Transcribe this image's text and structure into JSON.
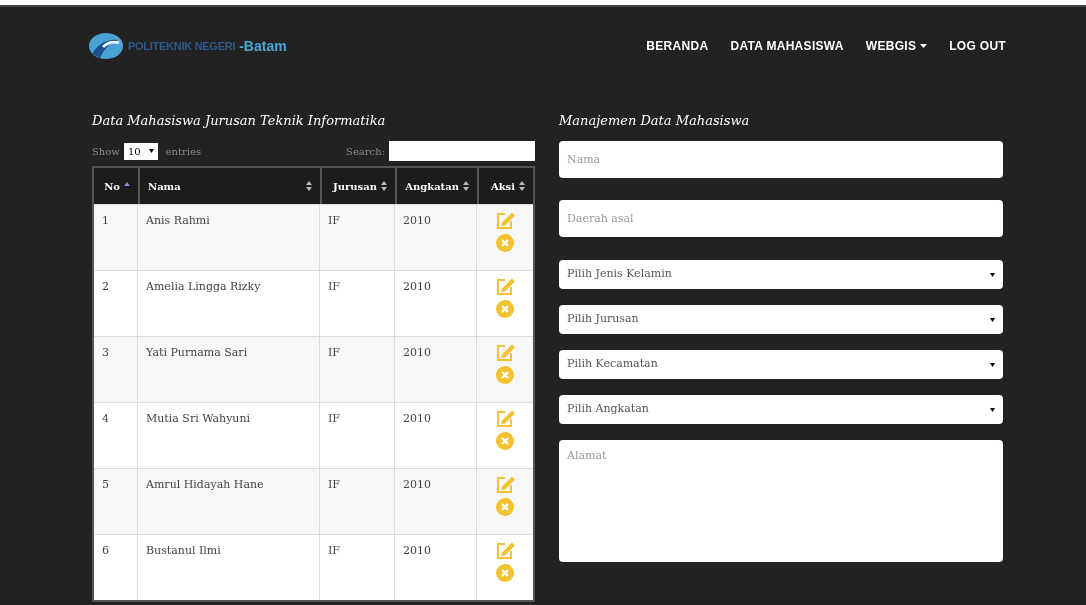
{
  "logo": {
    "prefix": "POLITEKNIK NEGERI",
    "suffix": "-Batam"
  },
  "nav": [
    {
      "label": "BERANDA",
      "dropdown": false
    },
    {
      "label": "DATA MAHASISWA",
      "dropdown": false
    },
    {
      "label": "WEBGIS",
      "dropdown": true
    },
    {
      "label": "LOG OUT",
      "dropdown": false
    }
  ],
  "table_section": {
    "title": "Data Mahasiswa Jurusan Teknik Informatika",
    "show_label": "Show",
    "page_size": "10",
    "entries_label": "entries",
    "search_label": "Search:",
    "columns": [
      {
        "label": "No",
        "sorted": true
      },
      {
        "label": "Nama",
        "sorted": false
      },
      {
        "label": "Jurusan",
        "sorted": false
      },
      {
        "label": "Angkatan",
        "sorted": false
      },
      {
        "label": "Aksi",
        "sorted": false
      }
    ],
    "rows": [
      {
        "no": "1",
        "nama": "Anis Rahmi",
        "jurusan": "IF",
        "angkatan": "2010"
      },
      {
        "no": "2",
        "nama": "Amelia Lingga Rizky",
        "jurusan": "IF",
        "angkatan": "2010"
      },
      {
        "no": "3",
        "nama": "Yati Purnama Sari",
        "jurusan": "IF",
        "angkatan": "2010"
      },
      {
        "no": "4",
        "nama": "Mutia Sri Wahyuni",
        "jurusan": "IF",
        "angkatan": "2010"
      },
      {
        "no": "5",
        "nama": "Amrul Hidayah Hane",
        "jurusan": "IF",
        "angkatan": "2010"
      },
      {
        "no": "6",
        "nama": "Bustanul Ilmi",
        "jurusan": "IF",
        "angkatan": "2010"
      }
    ]
  },
  "form": {
    "title": "Manajemen Data Mahasiswa",
    "fields": [
      {
        "kind": "text",
        "placeholder": "Nama"
      },
      {
        "kind": "text",
        "placeholder": "Daerah asal"
      },
      {
        "kind": "select",
        "placeholder": "Pilih Jenis Kelamin"
      },
      {
        "kind": "select",
        "placeholder": "Pilih Jurusan"
      },
      {
        "kind": "select",
        "placeholder": "Pilih Kecamatan"
      },
      {
        "kind": "select",
        "placeholder": "Pilih Angkatan"
      },
      {
        "kind": "textarea",
        "placeholder": "Alamat"
      }
    ]
  }
}
